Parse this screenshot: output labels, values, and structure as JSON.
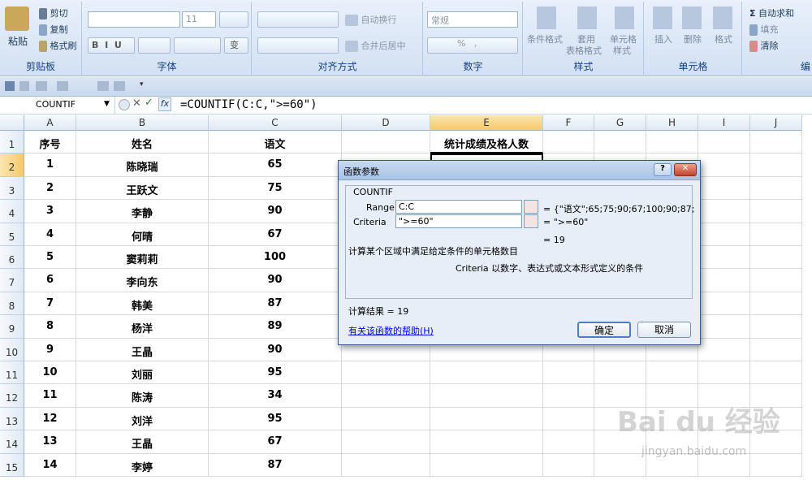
{
  "ribbon": {
    "clipboard": {
      "paste": "粘贴",
      "cut": "剪切",
      "copy": "复制",
      "format_painter": "格式刷",
      "label": "剪贴板"
    },
    "font": {
      "font_size": "11",
      "bold": "B",
      "italic": "I",
      "underline": "U",
      "phonetic": "变",
      "label": "字体"
    },
    "alignment": {
      "wrap_text": "自动换行",
      "merge_center": "合并后居中",
      "label": "对齐方式"
    },
    "number": {
      "format": "常规",
      "percent": "%",
      "comma": ",",
      "label": "数字"
    },
    "styles": {
      "conditional": "条件格式",
      "table_format_1": "套用",
      "table_format_2": "表格格式",
      "cell_styles_1": "单元格",
      "cell_styles_2": "样式",
      "label": "样式"
    },
    "cells": {
      "insert": "插入",
      "delete": "删除",
      "format": "格式",
      "label": "单元格"
    },
    "editing": {
      "autosum": "自动求和",
      "fill": "填充",
      "clear": "清除",
      "label": "编"
    }
  },
  "formula_bar": {
    "name_box": "COUNTIF",
    "fx": "fx",
    "formula": "=COUNTIF(C:C,\">=60\")"
  },
  "columns": [
    "A",
    "B",
    "C",
    "D",
    "E",
    "F",
    "G",
    "H",
    "I",
    "J"
  ],
  "headers": {
    "a": "序号",
    "b": "姓名",
    "c": "语文",
    "e": "统计成绩及格人数"
  },
  "rows": [
    {
      "num": "1",
      "name": "陈晓瑞",
      "score": "65"
    },
    {
      "num": "2",
      "name": "王跃文",
      "score": "75"
    },
    {
      "num": "3",
      "name": "李静",
      "score": "90"
    },
    {
      "num": "4",
      "name": "何晴",
      "score": "67"
    },
    {
      "num": "5",
      "name": "窦莉莉",
      "score": "100"
    },
    {
      "num": "6",
      "name": "李向东",
      "score": "90"
    },
    {
      "num": "7",
      "name": "韩美",
      "score": "87"
    },
    {
      "num": "8",
      "name": "杨洋",
      "score": "89"
    },
    {
      "num": "9",
      "name": "王晶",
      "score": "90"
    },
    {
      "num": "10",
      "name": "刘丽",
      "score": "95"
    },
    {
      "num": "11",
      "name": "陈涛",
      "score": "34"
    },
    {
      "num": "12",
      "name": "刘洋",
      "score": "95"
    },
    {
      "num": "13",
      "name": "王晶",
      "score": "67"
    },
    {
      "num": "14",
      "name": "李婷",
      "score": "87"
    }
  ],
  "row_numbers": [
    "1",
    "2",
    "3",
    "4",
    "5",
    "6",
    "7",
    "8",
    "9",
    "10",
    "11",
    "12",
    "13",
    "14",
    "15"
  ],
  "dialog": {
    "title": "函数参数",
    "help_btn": "?",
    "close_btn": "✕",
    "func_name": "COUNTIF",
    "range_label": "Range",
    "range_value": "C:C",
    "range_result": "= {\"语文\";65;75;90;67;100;90;87;",
    "criteria_label": "Criteria",
    "criteria_value": "\">=60\"",
    "criteria_result": "= \">=60\"",
    "total_result": "= 19",
    "description": "计算某个区域中满足给定条件的单元格数目",
    "param_desc": "Criteria  以数字、表达式或文本形式定义的条件",
    "calc_result": "计算结果 =  19",
    "help_link": "有关该函数的帮助(H)",
    "ok": "确定",
    "cancel": "取消"
  },
  "watermark": {
    "brand": "Bai du 经验",
    "url": "jingyan.baidu.com"
  },
  "colors": {
    "ribbon": "#d3e1f3",
    "link": "#0000ff",
    "header_border": "#000000"
  }
}
